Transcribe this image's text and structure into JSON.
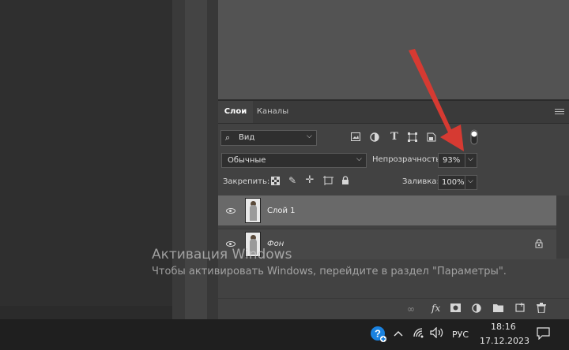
{
  "tabs": [
    {
      "label": "Слои"
    },
    {
      "label": "Каналы"
    }
  ],
  "filter": {
    "label": "Вид",
    "icon": "search-icon"
  },
  "filter_icons": [
    "image-filter-icon",
    "adjustment-filter-icon",
    "type-filter-icon",
    "shape-filter-icon",
    "smart-object-filter-icon",
    "filter-toggle-icon"
  ],
  "blend_mode": {
    "value": "Обычные"
  },
  "opacity": {
    "label": "Непрозрачность:",
    "value": "93%"
  },
  "lock": {
    "label": "Закрепить:",
    "icons": [
      "lock-transparent-icon",
      "lock-paint-icon",
      "lock-move-icon",
      "lock-artboard-icon",
      "lock-all-icon"
    ]
  },
  "fill": {
    "label": "Заливка:",
    "value": "100%"
  },
  "layers": [
    {
      "name": "Слой 1",
      "selected": true,
      "visible": true
    },
    {
      "name": "Фон",
      "selected": false,
      "visible": true,
      "locked": true
    }
  ],
  "bottom_icons": [
    "link-layers-icon",
    "fx-icon",
    "add-mask-icon",
    "adjustment-layer-icon",
    "new-group-icon",
    "new-layer-icon",
    "delete-icon"
  ],
  "bottom_fx_label": "fx",
  "watermark": {
    "title": "Активация Windows",
    "subtitle": "Чтобы активировать Windows, перейдите в раздел \"Параметры\"."
  },
  "taskbar": {
    "language": "РУС",
    "time": "18:16",
    "date": "17.12.2023",
    "tray_icons": [
      "help-icon",
      "chevron-up-icon",
      "wifi-icon",
      "volume-icon",
      "notification-icon"
    ]
  },
  "colors": {
    "panel": "#424242",
    "selected_layer": "#696969",
    "arrow": "#d63a32",
    "taskbar": "#1f1f1f"
  }
}
